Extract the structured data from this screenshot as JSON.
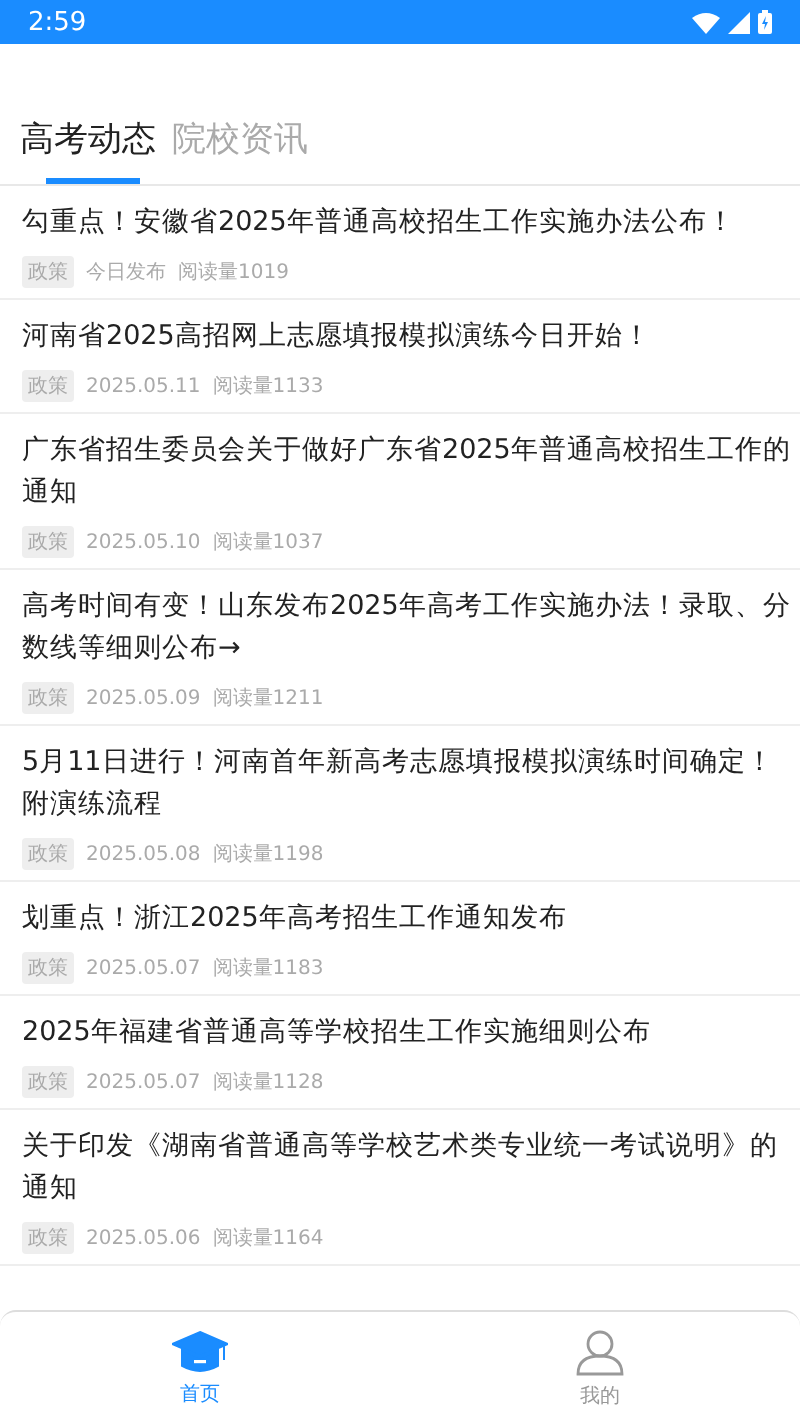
{
  "status_bar": {
    "time": "2:59"
  },
  "tabs": [
    {
      "label": "高考动态",
      "selected": true
    },
    {
      "label": "院校资讯",
      "selected": false
    }
  ],
  "articles": [
    {
      "title": "勾重点！安徽省2025年普通高校招生工作实施办法公布！",
      "tag": "政策",
      "date": "今日发布",
      "reads": "阅读量1019"
    },
    {
      "title": "河南省2025高招网上志愿填报模拟演练今日开始！",
      "tag": "政策",
      "date": "2025.05.11",
      "reads": "阅读量1133"
    },
    {
      "title": "广东省招生委员会关于做好广东省2025年普通高校招生工作的通知",
      "tag": "政策",
      "date": "2025.05.10",
      "reads": "阅读量1037"
    },
    {
      "title": "高考时间有变！山东发布2025年高考工作实施办法！录取、分数线等细则公布→",
      "tag": "政策",
      "date": "2025.05.09",
      "reads": "阅读量1211"
    },
    {
      "title": "5月11日进行！河南首年新高考志愿填报模拟演练时间确定！附演练流程",
      "tag": "政策",
      "date": "2025.05.08",
      "reads": "阅读量1198"
    },
    {
      "title": "划重点！浙江2025年高考招生工作通知发布",
      "tag": "政策",
      "date": "2025.05.07",
      "reads": "阅读量1183"
    },
    {
      "title": "2025年福建省普通高等学校招生工作实施细则公布",
      "tag": "政策",
      "date": "2025.05.07",
      "reads": "阅读量1128"
    },
    {
      "title": "关于印发《湖南省普通高等学校艺术类专业统一考试说明》的通知",
      "tag": "政策",
      "date": "2025.05.06",
      "reads": "阅读量1164"
    }
  ],
  "bottom_nav": [
    {
      "kind": "home",
      "label": "首页",
      "selected": true
    },
    {
      "kind": "profile",
      "label": "我的",
      "selected": false
    }
  ]
}
